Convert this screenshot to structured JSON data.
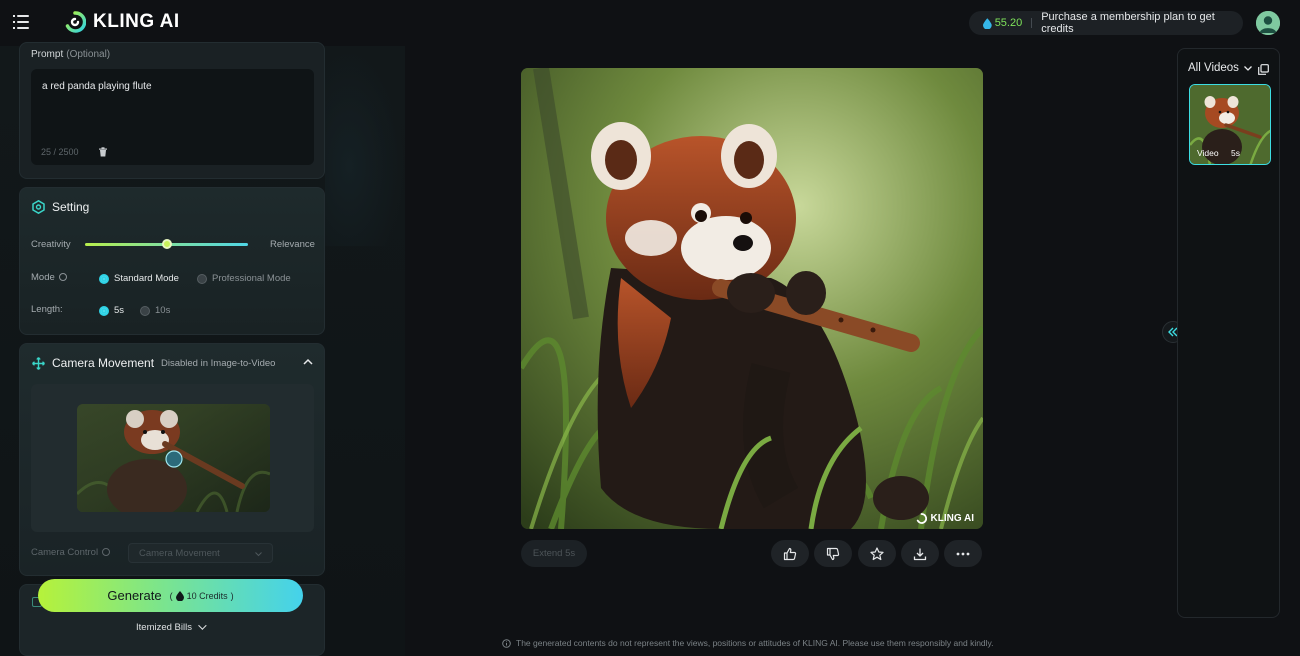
{
  "header": {
    "brand": "KLING AI",
    "credits_value": "55.20",
    "membership_text": "Purchase a membership plan to get credits"
  },
  "prompt": {
    "label": "Prompt",
    "optional": "(Optional)",
    "text": "a red panda playing flute",
    "counter": "25 / 2500"
  },
  "setting": {
    "title": "Setting",
    "creativity_label": "Creativity",
    "relevance_label": "Relevance",
    "creativity_relevance_balance": 0.5,
    "mode_label": "Mode",
    "mode_options": [
      "Standard Mode",
      "Professional Mode"
    ],
    "mode_selected": "Standard Mode",
    "length_label": "Length:",
    "length_options": [
      "5s",
      "10s"
    ],
    "length_selected": "5s"
  },
  "camera": {
    "title": "Camera Movement",
    "subtitle": "Disabled in Image-to-Video",
    "control_label": "Camera Control",
    "control_placeholder": "Camera Movement"
  },
  "generate": {
    "label": "Generate",
    "credits": "10 Credits",
    "itemized": "Itemized Bills"
  },
  "main": {
    "watermark": "KLING AI",
    "extend_label": "Extend 5s",
    "disclaimer": "The generated contents do not represent the views, positions or attitudes of KLING AI. Please use them responsibly and kindly."
  },
  "right": {
    "filter_label": "All Videos",
    "thumb_type": "Video",
    "thumb_duration": "5s"
  },
  "icons": {
    "menu": "menu-icon",
    "like": "thumbs-up-icon",
    "dislike": "thumbs-down-icon",
    "favorite": "star-icon",
    "download": "download-icon",
    "more": "more-icon",
    "collapse": "double-chevron-left-icon"
  },
  "colors": {
    "accent_green": "#b6f23a",
    "accent_cyan": "#3ddde2",
    "credits_green": "#7ee35a"
  }
}
